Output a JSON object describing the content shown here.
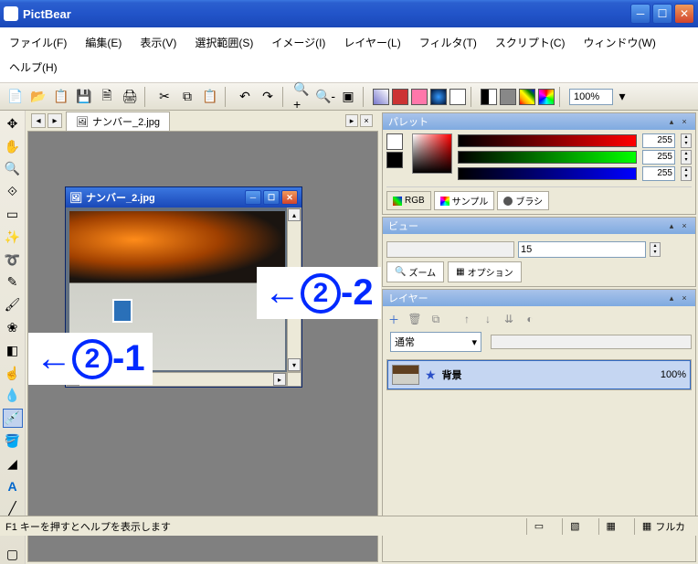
{
  "app": {
    "title": "PictBear"
  },
  "menu": {
    "file": "ファイル(F)",
    "edit": "編集(E)",
    "view": "表示(V)",
    "select": "選択範囲(S)",
    "image": "イメージ(I)",
    "layer": "レイヤー(L)",
    "filter": "フィルタ(T)",
    "script": "スクリプト(C)",
    "window": "ウィンドウ(W)",
    "help": "ヘルプ(H)"
  },
  "toolbar": {
    "zoom": "100%"
  },
  "tabs": {
    "doc1": "ナンバー_2.jpg"
  },
  "childwin": {
    "title": "ナンバー_2.jpg"
  },
  "annot": {
    "a1_arrow": "←",
    "a1_num": "2",
    "a1_suf": "-1",
    "a2_arrow": "←",
    "a2_num": "2",
    "a2_suf": "-2"
  },
  "panels": {
    "palette": {
      "title": "パレット",
      "r": "255",
      "g": "255",
      "b": "255",
      "tab_rgb": "RGB",
      "tab_sample": "サンプル",
      "tab_brush": "ブラシ"
    },
    "view": {
      "title": "ビュー",
      "value": "15",
      "zoom_btn": "ズーム",
      "option_btn": "オプション"
    },
    "layer": {
      "title": "レイヤー",
      "blend": "通常",
      "row_name": "背景",
      "row_opacity": "100%"
    }
  },
  "status": {
    "hint": "F1 キーを押すとヘルプを表示します",
    "mode": "フルカ"
  }
}
